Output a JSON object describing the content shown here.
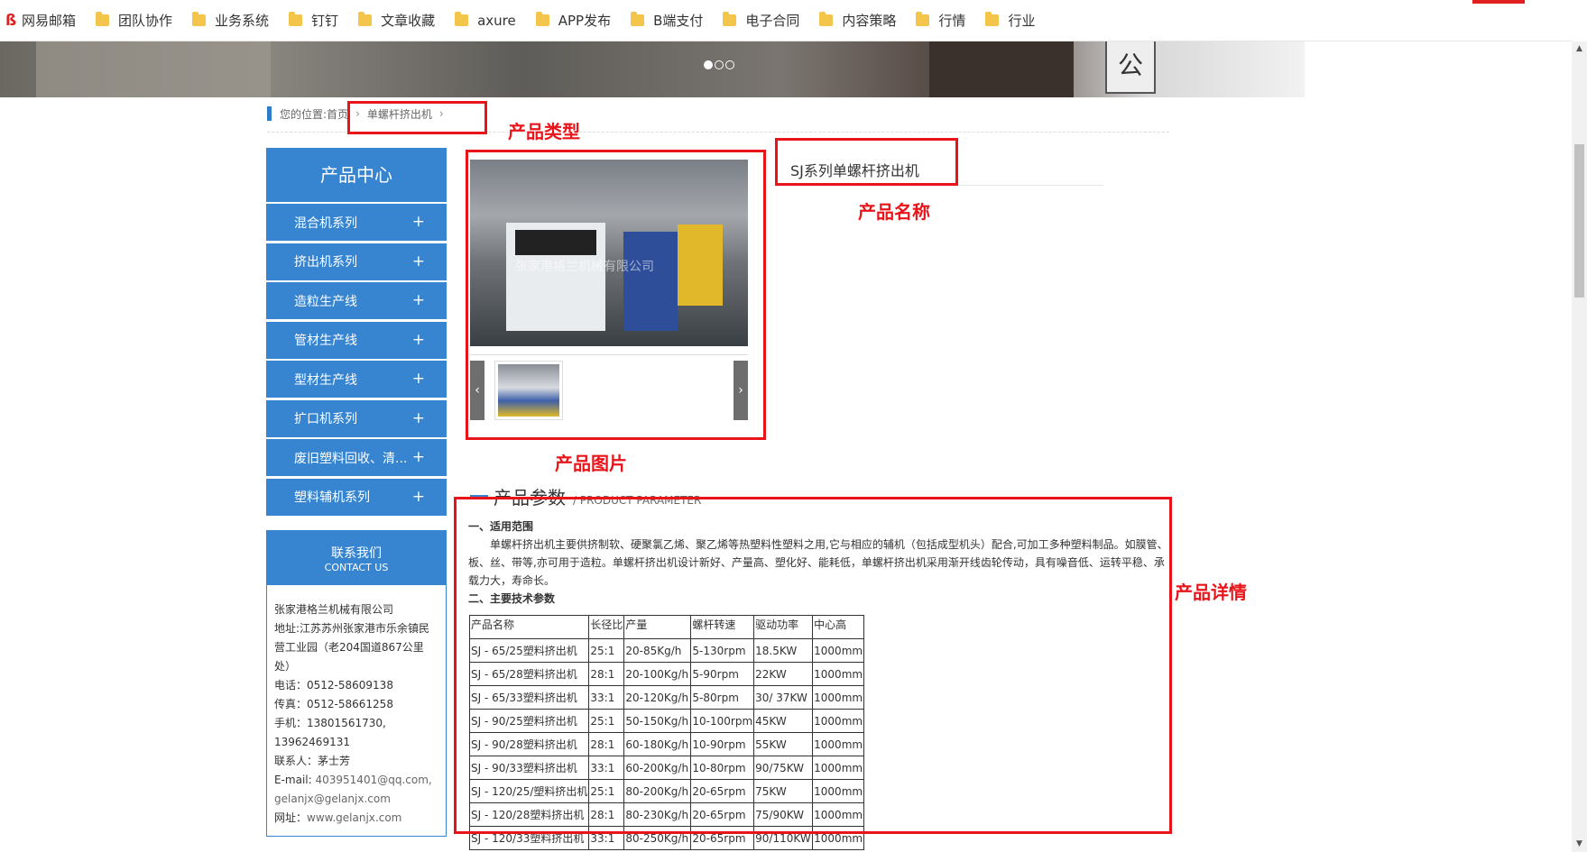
{
  "bookmarks": [
    {
      "label": "网易邮箱",
      "icon": "netease-mail-icon"
    },
    {
      "label": "团队协作",
      "icon": "folder-icon"
    },
    {
      "label": "业务系统",
      "icon": "folder-icon"
    },
    {
      "label": "钉钉",
      "icon": "folder-icon"
    },
    {
      "label": "文章收藏",
      "icon": "folder-icon"
    },
    {
      "label": "axure",
      "icon": "folder-icon"
    },
    {
      "label": "APP发布",
      "icon": "folder-icon"
    },
    {
      "label": "B端支付",
      "icon": "folder-icon"
    },
    {
      "label": "电子合同",
      "icon": "folder-icon"
    },
    {
      "label": "内容策略",
      "icon": "folder-icon"
    },
    {
      "label": "行情",
      "icon": "folder-icon"
    },
    {
      "label": "行业",
      "icon": "folder-icon"
    }
  ],
  "banner": {
    "slides": 3,
    "active_slide": 1,
    "sign_text": "公司"
  },
  "breadcrumb": {
    "prefix": "您的位置:",
    "home": "首页",
    "current": "单螺杆挤出机"
  },
  "sidebar": {
    "title": "产品中心",
    "items": [
      {
        "label": "混合机系列",
        "expand": "+"
      },
      {
        "label": "挤出机系列",
        "expand": "+"
      },
      {
        "label": "造粒生产线",
        "expand": "+"
      },
      {
        "label": "管材生产线",
        "expand": "+"
      },
      {
        "label": "型材生产线",
        "expand": "+"
      },
      {
        "label": "扩口机系列",
        "expand": "+"
      },
      {
        "label": "废旧塑料回收、清...",
        "expand": "+"
      },
      {
        "label": "塑料辅机系列",
        "expand": "+"
      }
    ]
  },
  "contact": {
    "title_zh": "联系我们",
    "title_en": "CONTACT US",
    "company": "张家港格兰机械有限公司",
    "address": "地址:江苏苏州张家港市乐余镇民营工业园（老204国道867公里处）",
    "phone": "电话：0512-58609138",
    "fax": "传真：0512-58661258",
    "mobile_label": "手机：",
    "mobile": "13801561730,",
    "mobile2": "13962469131",
    "person": "联系人：茅士芳",
    "email_label": "E-mail:",
    "email": "403951401@qq.com,",
    "email2": "gelanjx@gelanjx.com",
    "site_label": "网址：",
    "site": "www.gelanjx.com"
  },
  "gallery": {
    "watermark": "张家港格兰机械有限公司",
    "prev": "‹",
    "next": "›"
  },
  "product": {
    "name": "SJ系列单螺杆挤出机"
  },
  "params": {
    "title_zh": "产品参数",
    "title_en": "/ PRODUCT PARAMETER"
  },
  "details": {
    "sec1": "一、适用范围",
    "para1": "单螺杆挤出机主要供挤制软、硬聚氯乙烯、聚乙烯等热塑料性塑料之用,它与相应的辅机（包括成型机头）配合,可加工多种塑料制品。如膜管、板、丝、带等,亦可用于造粒。单螺杆挤出机设计新好、产量高、塑化好、能耗低，单螺杆挤出机采用渐开线齿轮传动，具有噪音低、运转平稳、承载力大，寿命长。",
    "sec2": "二、主要技术参数"
  },
  "spec_table": {
    "headers": [
      "产品名称",
      "长径比",
      "产量",
      "螺杆转速",
      "驱动功率",
      "中心高"
    ],
    "rows": [
      [
        "SJ - 65/25塑料挤出机",
        "25:1",
        "20-85Kg/h",
        "5-130rpm",
        "18.5KW",
        "1000mm"
      ],
      [
        "SJ - 65/28塑料挤出机",
        "28:1",
        "20-100Kg/h",
        "5-90rpm",
        "22KW",
        "1000mm"
      ],
      [
        "SJ - 65/33塑料挤出机",
        "33:1",
        "20-120Kg/h",
        "5-80rpm",
        "30/ 37KW",
        "1000mm"
      ],
      [
        "SJ - 90/25塑料挤出机",
        "25:1",
        "50-150Kg/h",
        "10-100rpm",
        "45KW",
        "1000mm"
      ],
      [
        "SJ - 90/28塑料挤出机",
        "28:1",
        "60-180Kg/h",
        "10-90rpm",
        "55KW",
        "1000mm"
      ],
      [
        "SJ - 90/33塑料挤出机",
        "33:1",
        "60-200Kg/h",
        "10-80rpm",
        "90/75KW",
        "1000mm"
      ],
      [
        "SJ - 120/25/塑料挤出机",
        "25:1",
        "80-200Kg/h",
        "20-65rpm",
        "75KW",
        "1000mm"
      ],
      [
        "SJ - 120/28塑料挤出机",
        "28:1",
        "80-230Kg/h",
        "20-65rpm",
        "75/90KW",
        "1000mm"
      ],
      [
        "SJ - 120/33塑料挤出机",
        "33:1",
        "80-250Kg/h",
        "20-65rpm",
        "90/110KW",
        "1000mm"
      ]
    ]
  },
  "annotations": {
    "type": "产品类型",
    "name": "产品名称",
    "image": "产品图片",
    "detail": "产品详情",
    "color": "#e8141a"
  }
}
